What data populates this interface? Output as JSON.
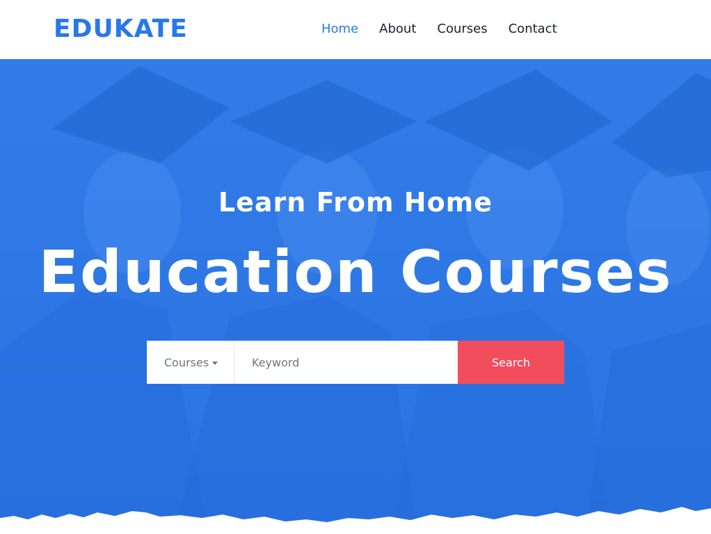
{
  "brand": "EDUKATE",
  "nav": {
    "home": "Home",
    "about": "About",
    "courses": "Courses",
    "contact": "Contact"
  },
  "hero": {
    "subtitle": "Learn From Home",
    "title": "Education Courses",
    "search": {
      "category_label": "Courses",
      "keyword_placeholder": "Keyword",
      "button_label": "Search"
    }
  },
  "colors": {
    "primary": "#2878EB",
    "accent": "#F14D5D",
    "text_dark": "#1a1f2b",
    "text_muted": "#6c757d"
  }
}
